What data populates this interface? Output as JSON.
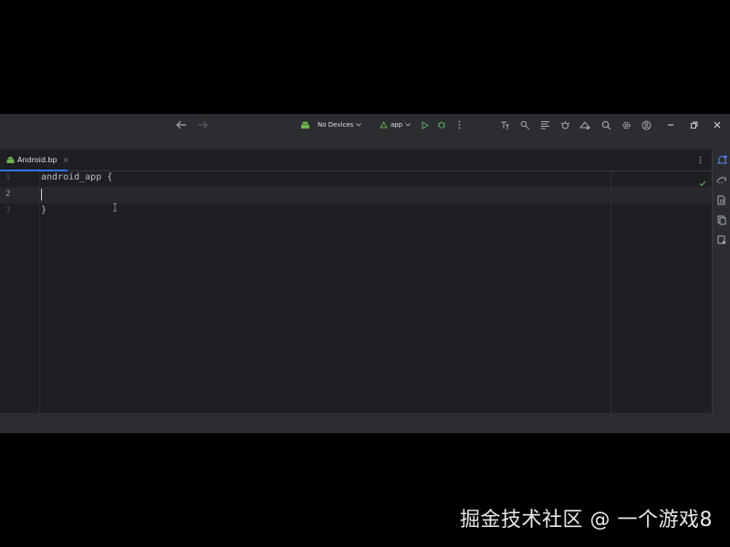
{
  "toolbar": {
    "device_selector": "No Devices",
    "run_config": "app"
  },
  "tabs": [
    {
      "label": "Android.bp",
      "close": "×"
    }
  ],
  "editor": {
    "line_numbers": [
      "1",
      "2",
      "3"
    ],
    "lines": [
      "android_app {",
      "",
      "}"
    ]
  },
  "icons": {
    "back": "back-arrow-icon",
    "forward": "forward-arrow-icon",
    "android": "android-icon",
    "run": "run-icon",
    "debug": "debug-icon"
  },
  "colors": {
    "ide_background": "#1e1f22",
    "toolbar": "#2b2d30",
    "tab_underline": "#3574f0",
    "android_green": "#6fb24e",
    "run_green": "#5fb865",
    "notification_blue": "#548af7"
  },
  "watermark": "掘金技术社区 @ 一个游戏8"
}
